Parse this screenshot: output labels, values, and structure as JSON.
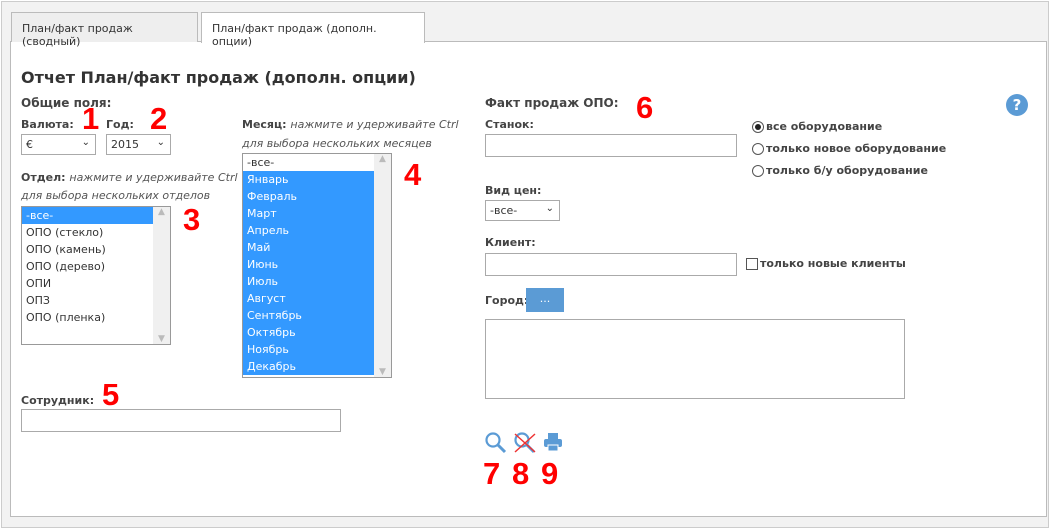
{
  "tabs": [
    "План/факт продаж (сводный)",
    "План/факт продаж (дополн. опции)"
  ],
  "title": "Отчет План/факт продаж (дополн. опции)",
  "general": {
    "heading": "Общие поля:",
    "currency_label": "Валюта:",
    "currency_value": "€",
    "year_label": "Год:",
    "year_value": "2015",
    "dept_label": "Отдел:",
    "dept_hint1": "нажмите и удерживайте Ctrl",
    "dept_hint2": "для выбора нескольких отделов",
    "departments": [
      "-все-",
      "ОПО (стекло)",
      "ОПО (камень)",
      "ОПО (дерево)",
      "ОПИ",
      "ОПЗ",
      "ОПО (пленка)"
    ],
    "month_label": "Месяц:",
    "month_hint1": "нажмите и удерживайте Ctrl",
    "month_hint2": "для выбора нескольких месяцев",
    "months": [
      "-все-",
      "Январь",
      "Февраль",
      "Март",
      "Апрель",
      "Май",
      "Июнь",
      "Июль",
      "Август",
      "Сентябрь",
      "Октябрь",
      "Ноябрь",
      "Декабрь"
    ],
    "employee_label": "Сотрудник:",
    "employee_value": ""
  },
  "fact": {
    "heading": "Факт продаж ОПО:",
    "machine_label": "Станок:",
    "machine_value": "",
    "radios": [
      "все оборудование",
      "только новое оборудование",
      "только б/у оборудование"
    ],
    "price_label": "Вид цен:",
    "price_value": "-все-",
    "client_label": "Клиент:",
    "client_value": "",
    "new_clients_label": "только новые клиенты",
    "city_label": "Город:",
    "city_button": "..."
  },
  "annotations": [
    "1",
    "2",
    "3",
    "4",
    "5",
    "6",
    "7",
    "8",
    "9"
  ],
  "help": "?"
}
